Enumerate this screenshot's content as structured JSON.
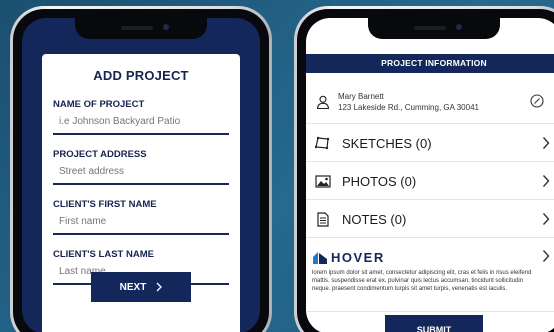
{
  "add_project": {
    "title": "ADD PROJECT",
    "fields": [
      {
        "label": "NAME OF PROJECT",
        "placeholder": "i.e Johnson Backyard Patio"
      },
      {
        "label": "PROJECT ADDRESS",
        "placeholder": "Street address"
      },
      {
        "label": "CLIENT'S FIRST NAME",
        "placeholder": "First name"
      },
      {
        "label": "CLIENT'S LAST NAME",
        "placeholder": "Last name"
      }
    ],
    "next_label": "NEXT"
  },
  "project_info": {
    "title": "PROJECT INFORMATION",
    "client_name": "Mary Barnett",
    "client_address": "123 Lakeside Rd., Cumming, GA 30041",
    "rows": [
      {
        "label": "SKETCHES (0)",
        "icon": "sketch-icon"
      },
      {
        "label": "PHOTOS (0)",
        "icon": "photo-icon"
      },
      {
        "label": "NOTES (0)",
        "icon": "notes-icon"
      }
    ],
    "hover_brand": "HOVER",
    "hover_text": "lorem ipsum dolor sit amet, consectetur adipiscing elit, cras et felis in risus eleifend mattis. suspendisse erat ex, pulvinar quis lectus accumsan, tincidunt sollicitudin neque. praesent condimentum turpis sit amet turpis, venenatis est iaculis.",
    "submit_label": "SUBMIT"
  },
  "colors": {
    "navy": "#14275a",
    "background": "#1e5a7c"
  }
}
